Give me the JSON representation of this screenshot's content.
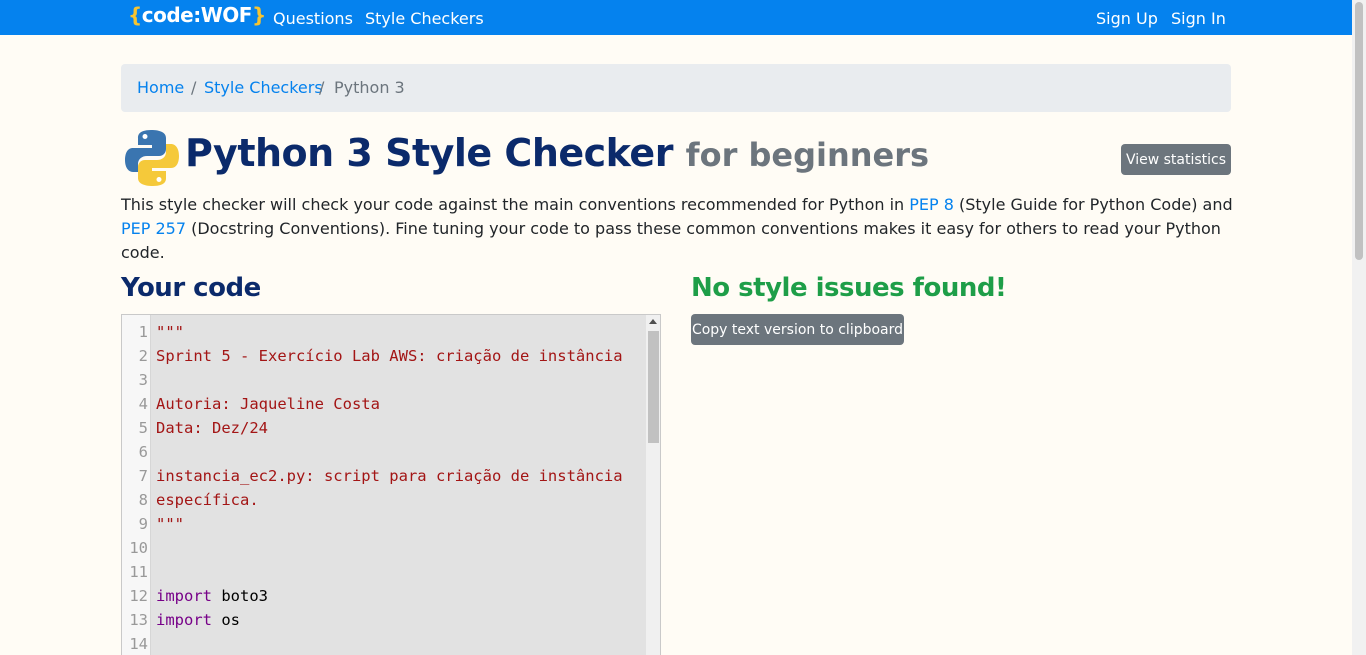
{
  "navbar": {
    "brand_open": "{",
    "brand_text": "code:WOF",
    "brand_close": "}",
    "links": [
      "Questions",
      "Style Checkers"
    ],
    "auth": [
      "Sign Up",
      "Sign In"
    ],
    "bg_color": "#0582ee"
  },
  "breadcrumb": {
    "home": "Home",
    "sep1": "/",
    "style_checkers": "Style Checkers",
    "sep2": "/",
    "current": "Python 3"
  },
  "header": {
    "title": "Python 3 Style Checker",
    "subtitle": "for beginners",
    "stats_button": "View statistics",
    "logo_icon": "python-logo-icon"
  },
  "intro": {
    "part1": "This style checker will check your code against the main conventions recommended for Python in ",
    "pep8_link": "PEP 8",
    "part2": " (Style Guide for Python Code) and ",
    "pep257_link": "PEP 257",
    "part3": " (Docstring Conventions). Fine tuning your code to pass these common conventions makes it easy for others to read your Python code."
  },
  "code_section": {
    "heading": "Your code",
    "lines": [
      {
        "num": "1",
        "text": "\"\"\"",
        "kind": "str"
      },
      {
        "num": "2",
        "text": "Sprint 5 - Exercício Lab AWS: criação de instância",
        "kind": "str"
      },
      {
        "num": "3",
        "text": "",
        "kind": "str"
      },
      {
        "num": "4",
        "text": "Autoria: Jaqueline Costa",
        "kind": "str"
      },
      {
        "num": "5",
        "text": "Data: Dez/24",
        "kind": "str"
      },
      {
        "num": "6",
        "text": "",
        "kind": "str"
      },
      {
        "num": "7",
        "text": "instancia_ec2.py: script para criação de instância",
        "kind": "str"
      },
      {
        "num": "8",
        "text": "específica.",
        "kind": "str"
      },
      {
        "num": "9",
        "text": "\"\"\"",
        "kind": "str"
      },
      {
        "num": "10",
        "text": "",
        "kind": "plain"
      },
      {
        "num": "11",
        "text": "",
        "kind": "plain"
      },
      {
        "num": "12",
        "kw": "import",
        "text": " boto3",
        "kind": "import"
      },
      {
        "num": "13",
        "kw": "import",
        "text": " os",
        "kind": "import"
      },
      {
        "num": "14",
        "text": "",
        "kind": "plain"
      }
    ]
  },
  "result": {
    "heading": "No style issues found!",
    "copy_button": "Copy text version to clipboard",
    "color": "#1e9e48"
  }
}
